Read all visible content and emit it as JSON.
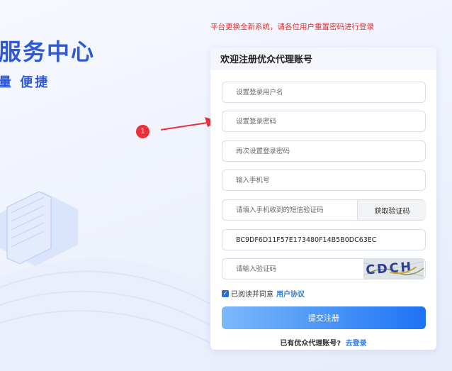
{
  "hero": {
    "title": "服务中心",
    "subtitle": "量  便捷"
  },
  "notice": "平台更换全新系统，请各位用户重置密码进行登录",
  "step_marker": "1",
  "form": {
    "title": "欢迎注册优众代理账号",
    "username_placeholder": "设置登录用户名",
    "password_placeholder": "设置登录密码",
    "password_confirm_placeholder": "再次设置登录密码",
    "phone_placeholder": "输入手机号",
    "sms_code_placeholder": "请填入手机收到的短信验证码",
    "sms_button": "获取验证码",
    "token_value": "BC9DF6D11F57E173480F14B5B0DC63EC",
    "captcha_placeholder": "请输入验证码",
    "captcha_text": "CDCH",
    "agree_text": "已阅读并同意",
    "agree_link": "用户协议",
    "agree_checked": true,
    "submit": "提交注册",
    "login_prompt": "已有优众代理账号?",
    "login_link": "去登录"
  },
  "colors": {
    "brand_blue": "#2f58d6",
    "notice_red": "#e03030",
    "link_blue": "#2f7be0",
    "badge_red": "#e8323a",
    "submit_start": "#7cb9f9",
    "submit_end": "#1d73f4"
  }
}
